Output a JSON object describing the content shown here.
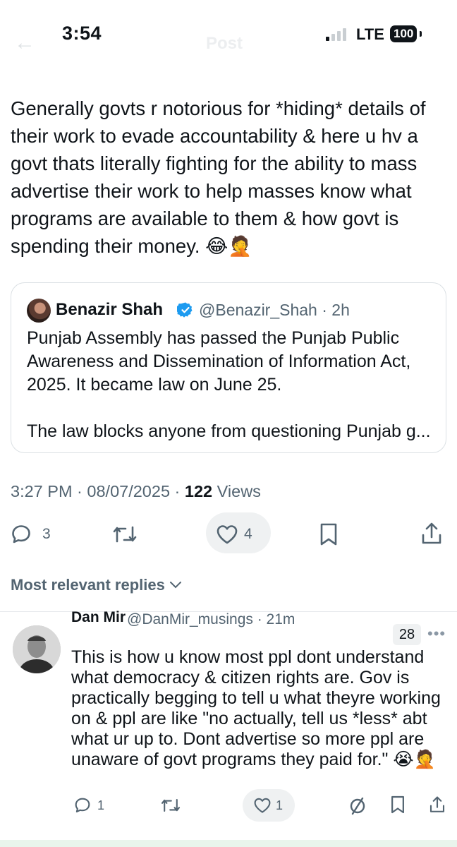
{
  "status_bar": {
    "time": "3:54",
    "network": "LTE",
    "battery": "100",
    "ghost_title": "Post"
  },
  "tweet": {
    "text": "Generally govts r notorious for *hiding* details of their work to evade accountability & here u hv a govt thats literally fighting for the ability to mass advertise their work to help masses know what programs are available to them & how govt is spending their money. 😂🤦",
    "quote": {
      "author_name": "Benazir Shah",
      "handle_time": "@Benazir_Shah · 2h",
      "text_1": "Punjab Assembly has passed the Punjab Public Awareness and Dissemination of Information Act, 2025. It became law on June 25.",
      "text_2": "The law blocks anyone from questioning Punjab g..."
    },
    "meta_time": "3:27 PM · 08/07/2025 · ",
    "views_count": "122",
    "views_label": " Views",
    "actions": {
      "replies": "3",
      "likes": "4"
    }
  },
  "replies_header": "Most relevant replies",
  "reply": {
    "author_name": "Dan Mir",
    "handle_time": "@DanMir_musings · 21m",
    "badge": "28",
    "text": "This is how u know most ppl dont understand what democracy & citizen rights are. Gov is practically begging to tell u what theyre working on & ppl are like \"no actually, tell us *less* abt what ur up to. Dont advertise so more ppl are unaware of govt programs they paid for.\" 😭🤦",
    "actions": {
      "replies": "1",
      "likes": "1"
    }
  },
  "colors": {
    "accent": "#1d9bf0",
    "text": "#0f1419",
    "muted": "#536471"
  }
}
